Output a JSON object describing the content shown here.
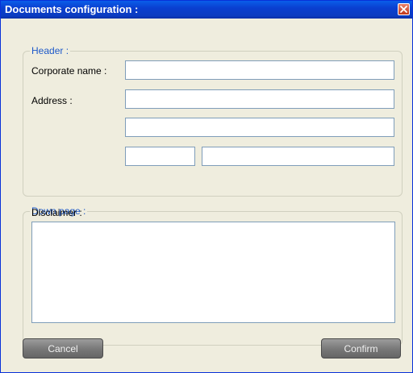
{
  "window": {
    "title": "Documents configuration :"
  },
  "header_section": {
    "legend": "Header :",
    "corporate_name_label": "Corporate name :",
    "corporate_name_value": "",
    "address_label": "Address :",
    "address_line1_value": "",
    "address_line2_value": "",
    "postal_code_value": "",
    "city_value": ""
  },
  "footer_section": {
    "legend": "Down page :",
    "disclaimer_label": "Disclaimer :",
    "disclaimer_value": ""
  },
  "buttons": {
    "cancel_label": "Cancel",
    "confirm_label": "Confirm"
  },
  "icons": {
    "close": "close-icon"
  },
  "colors": {
    "title_bar": "#0a3fd0",
    "legend_text": "#1d59c9",
    "close_button": "#c1391c",
    "button_face": "#777777"
  }
}
